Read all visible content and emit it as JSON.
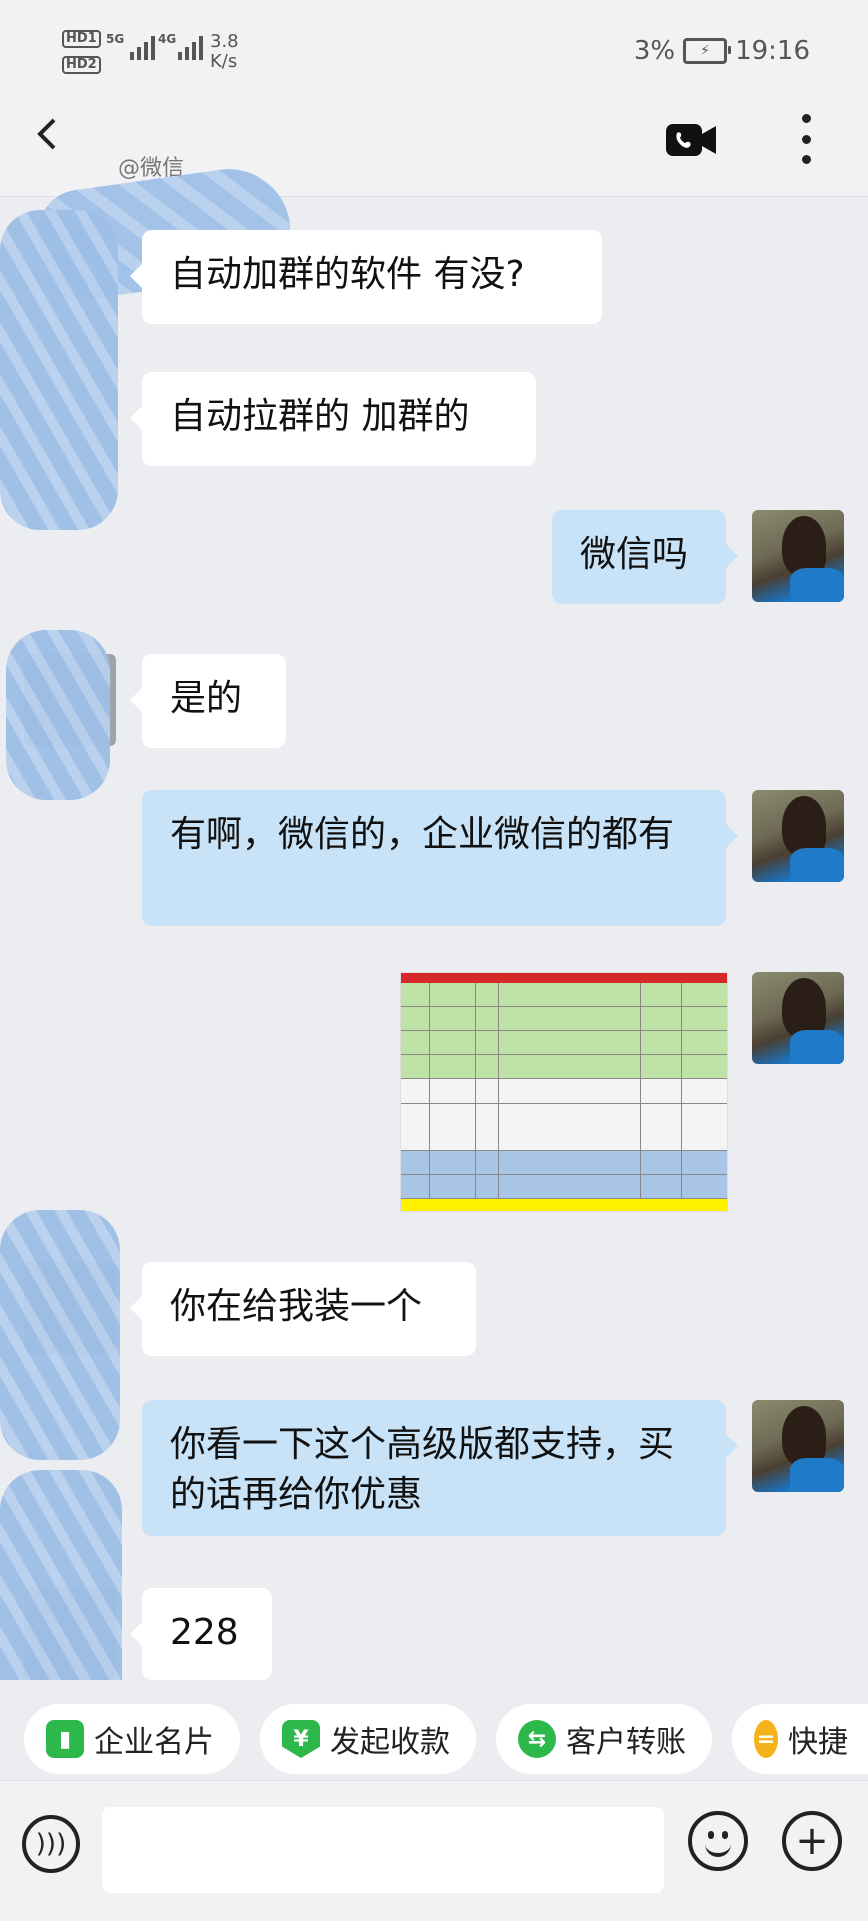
{
  "status_bar": {
    "hd1": "HD1",
    "hd2": "HD2",
    "sig1": "5G",
    "sig2": "4G",
    "speed_value": "3.8",
    "speed_unit": "K/s",
    "battery_percent": "3%",
    "time": "19:16"
  },
  "header": {
    "contact_sub": "@微信",
    "icons": [
      "back-icon",
      "video-call-icon",
      "more-icon"
    ]
  },
  "messages": [
    {
      "side": "left",
      "text": "自动加群的软件 有没?"
    },
    {
      "side": "left",
      "text": "自动拉群的  加群的"
    },
    {
      "side": "right",
      "text": "微信吗"
    },
    {
      "side": "left",
      "text": "是的"
    },
    {
      "side": "right",
      "text": "有啊，微信的，企业微信的都有"
    },
    {
      "side": "right",
      "type": "image"
    },
    {
      "side": "left",
      "text": "你在给我装一个"
    },
    {
      "side": "right",
      "text": "你看一下这个高级版都支持，买的话再给你优惠"
    },
    {
      "side": "left",
      "text": "228"
    }
  ],
  "quick_actions": [
    {
      "label": "企业名片",
      "icon": "business-card-icon",
      "color": "#2DB84B"
    },
    {
      "label": "发起收款",
      "icon": "yuan-icon",
      "color": "#2DB84B"
    },
    {
      "label": "客户转账",
      "icon": "transfer-icon",
      "color": "#2DB84B"
    },
    {
      "label": "快捷",
      "icon": "quick-reply-icon",
      "color": "#F5B31B"
    }
  ],
  "input_bar": {
    "placeholder": "",
    "icons": [
      "voice-icon",
      "emoji-icon",
      "plus-icon"
    ]
  },
  "colors": {
    "background": "#ECEDF1",
    "bubble_self": "#C8E2F7",
    "bubble_other": "#FFFFFF",
    "accent_green": "#2DB84B"
  }
}
